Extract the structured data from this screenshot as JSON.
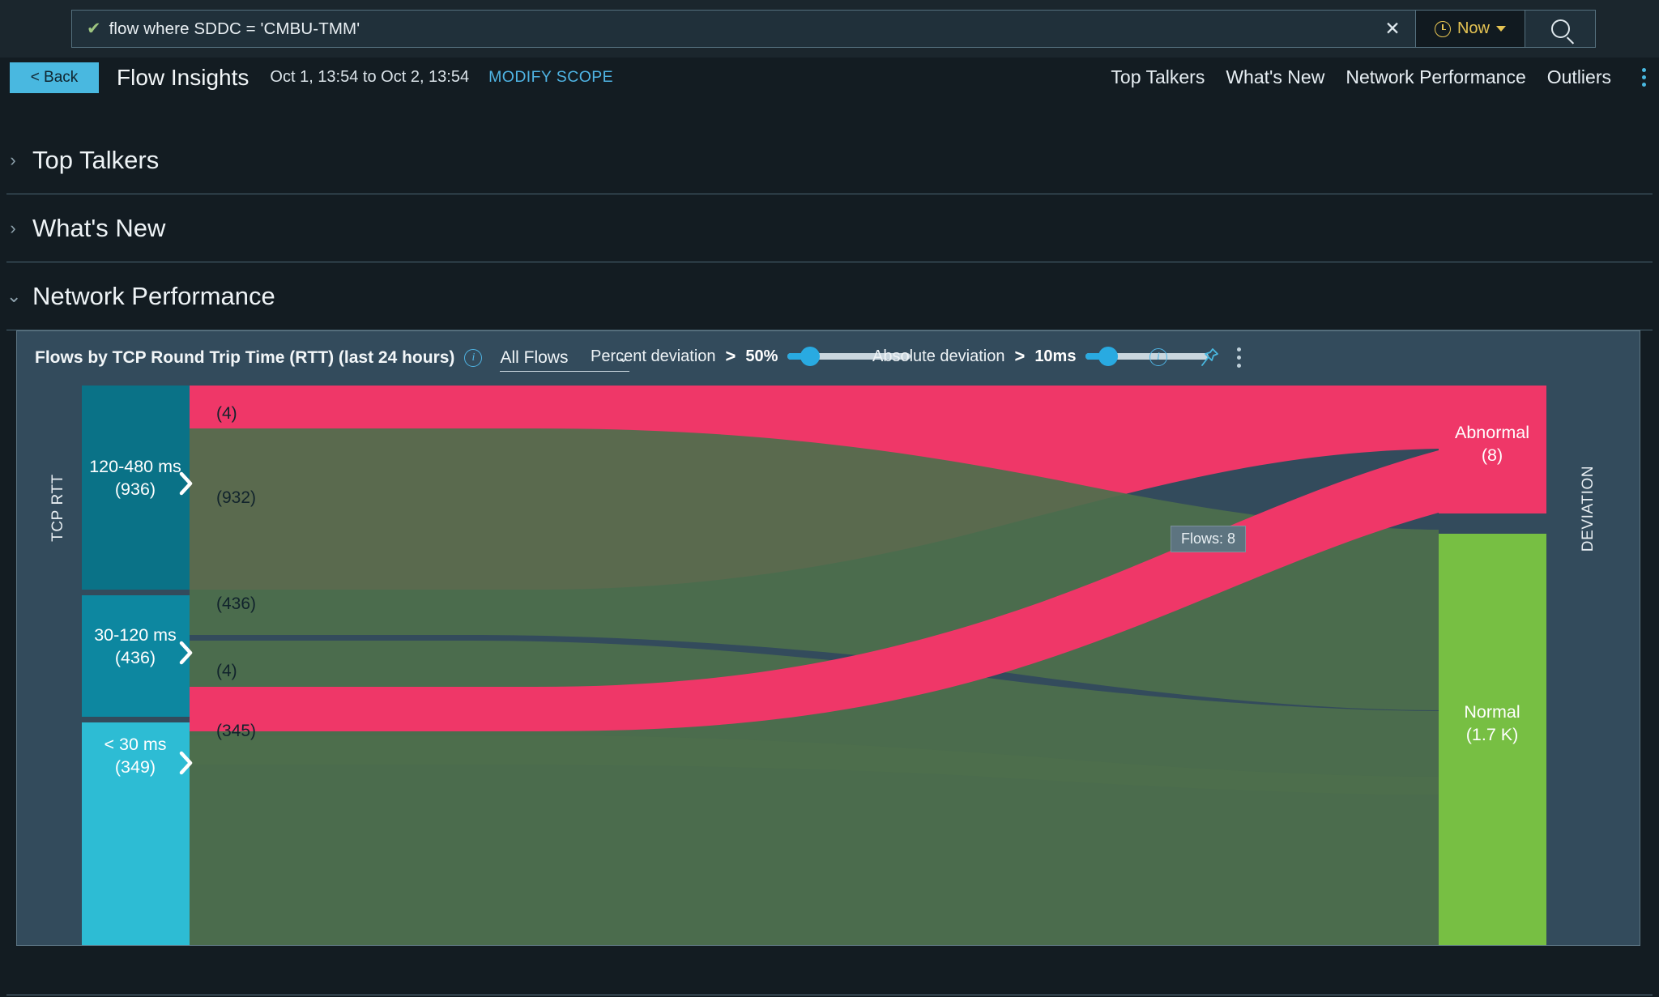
{
  "search": {
    "query_value": "flow where SDDC = 'CMBU-TMM'",
    "check_icon": "check-icon",
    "clear_label": "✕",
    "time_label": "Now",
    "time_icon": "clock-icon",
    "search_icon": "search-icon"
  },
  "subheader": {
    "back_label": "< Back",
    "title": "Flow Insights",
    "daterange": "Oct 1, 13:54 to Oct 2, 13:54",
    "modify_scope": "MODIFY SCOPE",
    "nav": [
      {
        "label": "Top Talkers"
      },
      {
        "label": "What's New"
      },
      {
        "label": "Network Performance"
      },
      {
        "label": "Outliers"
      }
    ],
    "overflow_icon": "kebab-menu-icon"
  },
  "sections": [
    {
      "label": "Top Talkers",
      "expanded": false,
      "chevron": "›"
    },
    {
      "label": "What's New",
      "expanded": false,
      "chevron": "›"
    },
    {
      "label": "Network Performance",
      "expanded": true,
      "chevron": "⌄"
    }
  ],
  "panel": {
    "title": "Flows by TCP Round Trip Time (RTT) (last 24 hours)",
    "title_info_icon": "info-icon",
    "flow_filter_value": "All Flows",
    "flow_filter_caret": "⌄",
    "percent_deviation": {
      "label": "Percent deviation",
      "operator": ">",
      "value": "50%",
      "knob_pct": 18
    },
    "absolute_deviation": {
      "label": "Absolute deviation",
      "operator": ">",
      "value": "10ms",
      "knob_pct": 18
    },
    "deviation_info_icon": "info-icon",
    "pin_icon": "pin-icon",
    "overflow_icon": "kebab-menu-icon",
    "tooltip": "Flows: 8"
  },
  "colors": {
    "panel_bg": "#334b5c",
    "page_bg": "#131c22",
    "accent_blue": "#49b8e0",
    "abnormal": "#ef3768",
    "normal": "#77bf43",
    "rtt_high": "#0a7287",
    "rtt_mid": "#0d87a0",
    "rtt_low": "#2dbcd4",
    "ribbon_normal": "#4d6f4c",
    "time_yellow": "#e6c453"
  },
  "chart_data": {
    "type": "sankey",
    "title": "Flows by TCP Round Trip Time (RTT) (last 24 hours)",
    "left_axis_label": "TCP RTT",
    "right_axis_label": "DEVIATION",
    "source_nodes": [
      {
        "name": "120-480 ms",
        "value": 936,
        "value_label": "(936)",
        "color": "#0a7287"
      },
      {
        "name": "30-120 ms",
        "value": 436,
        "value_label": "(436)",
        "color": "#0d87a0"
      },
      {
        "name": "< 30 ms",
        "value": 349,
        "value_label": "(349)",
        "color": "#2dbcd4"
      }
    ],
    "target_nodes": [
      {
        "name": "Abnormal",
        "value": 8,
        "value_label": "(8)",
        "color": "#ef3768"
      },
      {
        "name": "Normal",
        "value": 1721,
        "value_label": "(1.7 K)",
        "color": "#77bf43"
      }
    ],
    "links": [
      {
        "source": "120-480 ms",
        "target": "Abnormal",
        "value": 4,
        "label": "(4)"
      },
      {
        "source": "120-480 ms",
        "target": "Normal",
        "value": 932,
        "label": "(932)"
      },
      {
        "source": "30-120 ms",
        "target": "Normal",
        "value": 436,
        "label": "(436)"
      },
      {
        "source": "< 30 ms",
        "target": "Abnormal",
        "value": 4,
        "label": "(4)"
      },
      {
        "source": "< 30 ms",
        "target": "Normal",
        "value": 345,
        "label": "(345)"
      }
    ]
  }
}
